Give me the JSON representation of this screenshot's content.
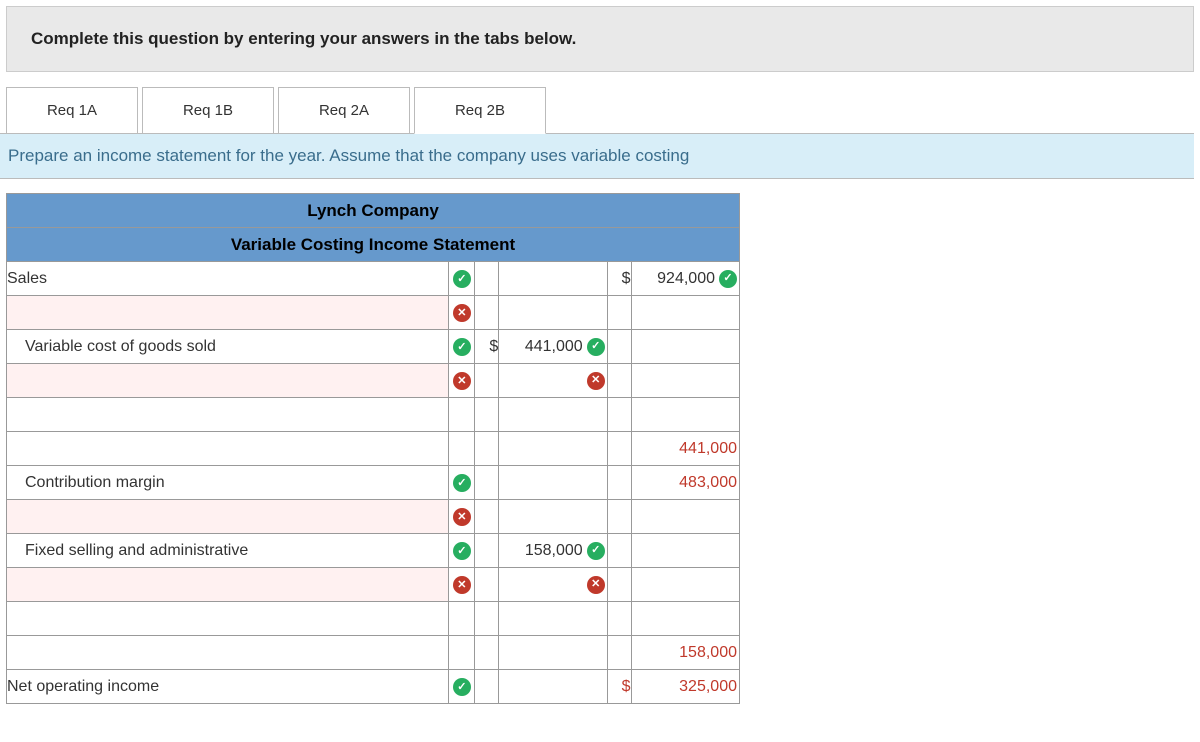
{
  "instruction": "Complete this question by entering your answers in the tabs below.",
  "tabs": [
    {
      "label": "Req 1A",
      "active": false
    },
    {
      "label": "Req 1B",
      "active": false
    },
    {
      "label": "Req 2A",
      "active": false
    },
    {
      "label": "Req 2B",
      "active": true
    }
  ],
  "subheader": "Prepare an income statement for the year. Assume that the company uses variable costing",
  "table": {
    "company": "Lynch Company",
    "title": "Variable Costing Income Statement",
    "rows": {
      "sales_label": "Sales",
      "sales_currency": "$",
      "sales_value": "924,000",
      "vcogs_label": "Variable cost of goods sold",
      "vcogs_currency": "$",
      "vcogs_value": "441,000",
      "total_vcogs_value": "441,000",
      "cm_label": "Contribution margin",
      "cm_value": "483,000",
      "fsa_label": "Fixed selling and administrative",
      "fsa_value": "158,000",
      "total_fixed_value": "158,000",
      "noi_label": "Net operating income",
      "noi_currency": "$",
      "noi_value": "325,000"
    }
  },
  "icons": {
    "ok": "✓",
    "bad": "✕"
  }
}
